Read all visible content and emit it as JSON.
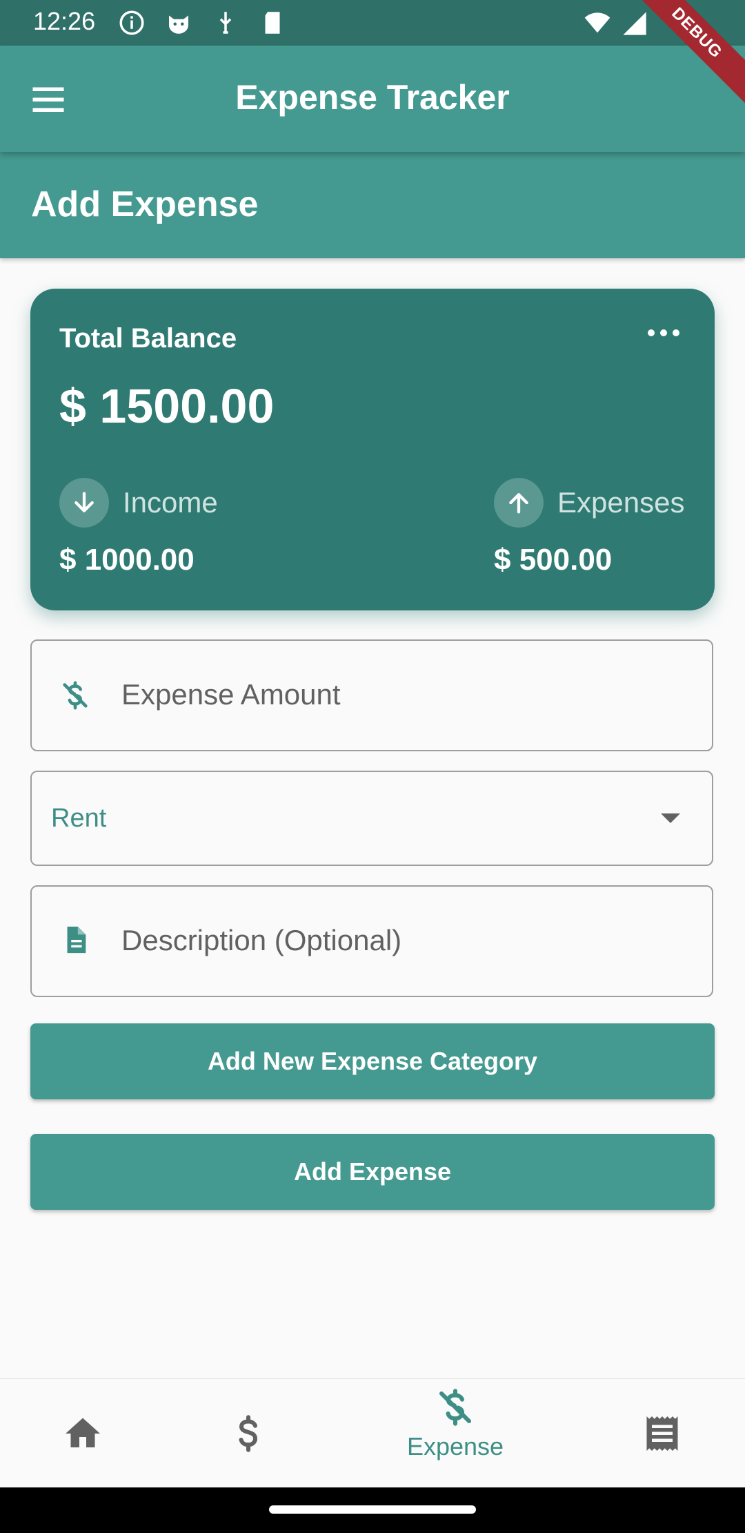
{
  "status_bar": {
    "time": "12:26",
    "icons": [
      "info-icon",
      "cat-icon",
      "usb-icon",
      "sd-card-icon"
    ],
    "right_icons": [
      "wifi-icon",
      "signal-icon"
    ]
  },
  "debug_banner": "DEBUG",
  "app_bar": {
    "title": "Expense Tracker",
    "menu_icon": "hamburger-menu-icon"
  },
  "page": {
    "title": "Add Expense"
  },
  "balance_card": {
    "label": "Total Balance",
    "amount": "$ 1500.00",
    "income": {
      "label": "Income",
      "value": "$ 1000.00",
      "icon": "arrow-down-icon"
    },
    "expenses": {
      "label": "Expenses",
      "value": "$ 500.00",
      "icon": "arrow-up-icon"
    },
    "more_icon": "more-horizontal-icon"
  },
  "form": {
    "amount_placeholder": "Expense Amount",
    "category_selected": "Rent",
    "description_placeholder": "Description (Optional)"
  },
  "buttons": {
    "add_category": "Add New Expense Category",
    "add_expense": "Add Expense"
  },
  "bottom_nav": {
    "items": [
      {
        "icon": "home-icon",
        "label": ""
      },
      {
        "icon": "dollar-icon",
        "label": ""
      },
      {
        "icon": "money-off-icon",
        "label": "Expense",
        "active": true
      },
      {
        "icon": "receipt-icon",
        "label": ""
      }
    ]
  },
  "colors": {
    "primary": "#449a90",
    "card": "#2f7a73",
    "accent_text": "#3d8f86",
    "status_bar": "#2f7068",
    "debug": "#a3282f"
  }
}
